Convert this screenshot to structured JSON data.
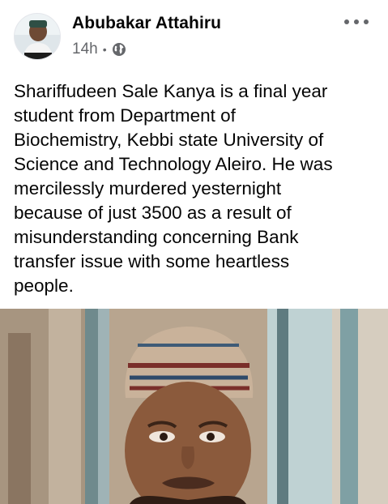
{
  "post": {
    "author": "Abubakar Attahiru",
    "timestamp": "14h",
    "separator": "•",
    "audience_icon": "globe-icon",
    "more_icon": "more-options-icon",
    "text": "Shariffudeen Sale Kanya is a final year\nstudent from Department of\nBiochemistry, Kebbi state University of\nScience and Technology Aleiro. He was\nmercilessly murdered yesternight\nbecause of just 3500 as a result of\nmisunderstanding concerning Bank\ntransfer issue with some heartless\npeople."
  },
  "colors": {
    "text_primary": "#050505",
    "text_secondary": "#65676b",
    "background": "#ffffff"
  }
}
